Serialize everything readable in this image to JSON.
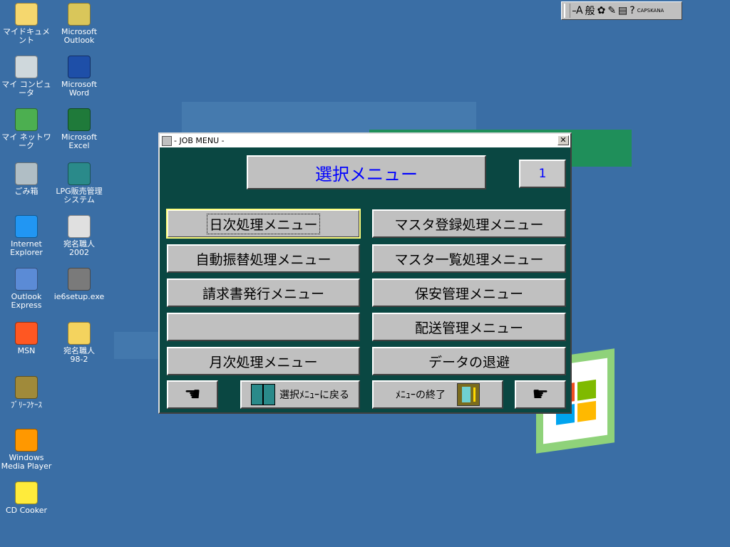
{
  "desktop": {
    "icons": [
      {
        "label": "マイドキュメント",
        "icon": "my-documents-icon"
      },
      {
        "label": "Microsoft\nOutlook",
        "icon": "outlook-icon"
      },
      {
        "label": "マイ コンピュータ",
        "icon": "my-computer-icon"
      },
      {
        "label": "Microsoft\nWord",
        "icon": "word-icon"
      },
      {
        "label": "マイ ネットワーク",
        "icon": "network-icon"
      },
      {
        "label": "Microsoft\nExcel",
        "icon": "excel-icon"
      },
      {
        "label": "ごみ箱",
        "icon": "recycle-bin-icon"
      },
      {
        "label": "LPG販売管理\nシステム",
        "icon": "lpg-system-icon"
      },
      {
        "label": "Internet\nExplorer",
        "icon": "ie-icon"
      },
      {
        "label": "宛名職人\n2002",
        "icon": "atena-2002-icon"
      },
      {
        "label": "Outlook\nExpress",
        "icon": "outlook-express-icon"
      },
      {
        "label": "ie6setup.exe",
        "icon": "setup-exe-icon"
      },
      {
        "label": "MSN",
        "icon": "msn-icon"
      },
      {
        "label": "宛名職人\n98-2",
        "icon": "folder-icon"
      },
      {
        "label": "ﾌﾞﾘｰﾌｹｰｽ",
        "icon": "briefcase-icon"
      },
      {
        "label": "Windows\nMedia Player",
        "icon": "media-player-icon"
      },
      {
        "label": "CD Cooker",
        "icon": "cd-cooker-icon"
      }
    ]
  },
  "ime": {
    "mode": "A",
    "general": "般",
    "caps": "CAPS",
    "kana": "KANA"
  },
  "window": {
    "title": "- JOB MENU -",
    "close": "✕",
    "header": "選択メニュー",
    "page_number": "1",
    "buttons": {
      "daily": "日次処理メニュー",
      "master_register": "マスタ登録処理メニュー",
      "auto_transfer": "自動振替処理メニュー",
      "master_list": "マスタ一覧処理メニュー",
      "invoice": "請求書発行メニュー",
      "security": "保安管理メニュー",
      "blank": "",
      "delivery": "配送管理メニュー",
      "monthly": "月次処理メニュー",
      "data_backup": "データの退避",
      "back_to_menu": "選択ﾒﾆｭｰに戻る",
      "exit_menu": "ﾒﾆｭｰの終了"
    },
    "prev_hand": "☚",
    "next_hand": "☛"
  },
  "colors": {
    "desktop": "#3a6ea5",
    "window_bg": "#0a4742",
    "button": "#c0c0c0",
    "header_text": "#0000ff"
  }
}
